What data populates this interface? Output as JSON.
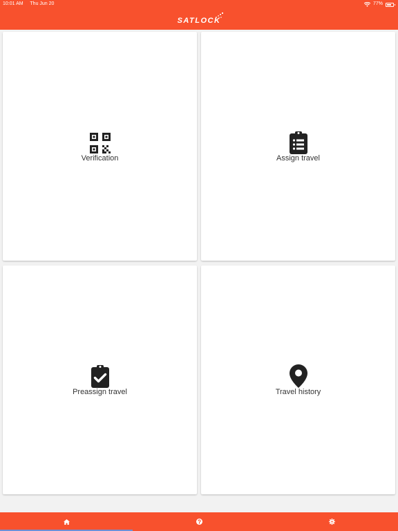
{
  "status_bar": {
    "time": "10:01 AM",
    "date": "Thu Jun 20",
    "battery": "77%",
    "battery_level": 0.77
  },
  "header": {
    "logo_text": "SATLOCK",
    "background": "#f8512d"
  },
  "tiles": [
    {
      "label": "Verification",
      "icon": "qr-code-icon"
    },
    {
      "label": "Assign travel",
      "icon": "clipboard-list-icon"
    },
    {
      "label": "Preassign travel",
      "icon": "clipboard-check-icon"
    },
    {
      "label": "Travel history",
      "icon": "map-marker-icon"
    }
  ],
  "bottom_nav": {
    "items": [
      {
        "icon": "home-icon",
        "active": true
      },
      {
        "icon": "help-icon",
        "active": false
      },
      {
        "icon": "gear-icon",
        "active": false
      }
    ],
    "active_color": "#6d8fd6"
  }
}
